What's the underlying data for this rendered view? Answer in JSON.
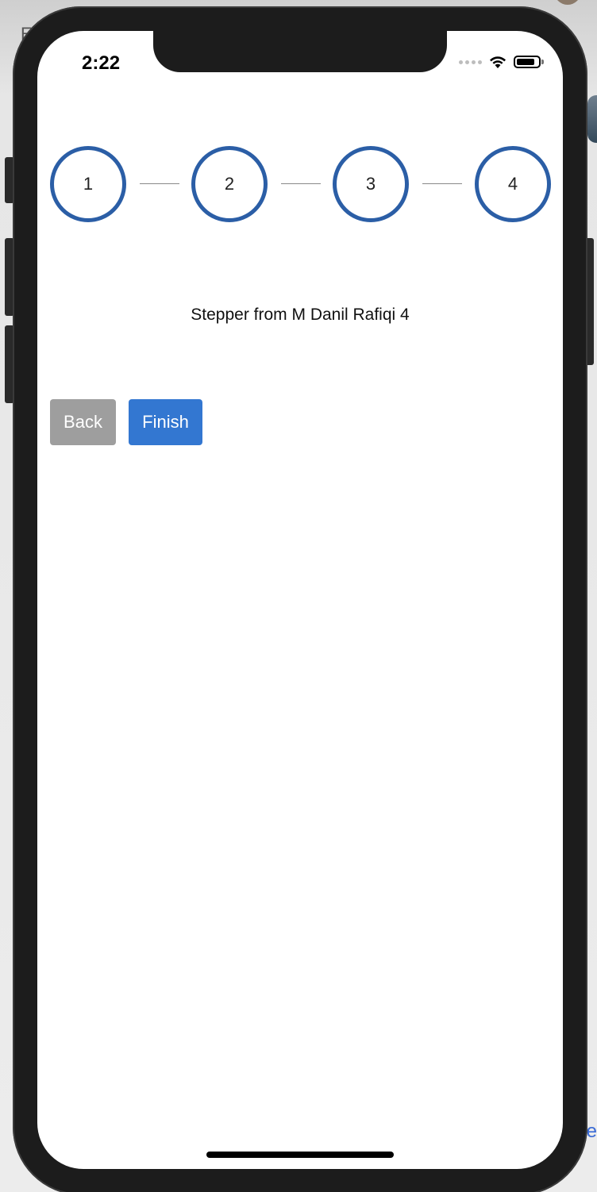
{
  "status_bar": {
    "time": "2:22"
  },
  "stepper": {
    "steps": [
      "1",
      "2",
      "3",
      "4"
    ],
    "accent_color": "#2b5ea6"
  },
  "content": {
    "text": "Stepper from M Danil Rafiqi 4"
  },
  "actions": {
    "back_label": "Back",
    "finish_label": "Finish",
    "back_color": "#9e9e9e",
    "finish_color": "#3377d1"
  },
  "background": {
    "corner_letter": "E",
    "corner_text": "ze"
  }
}
